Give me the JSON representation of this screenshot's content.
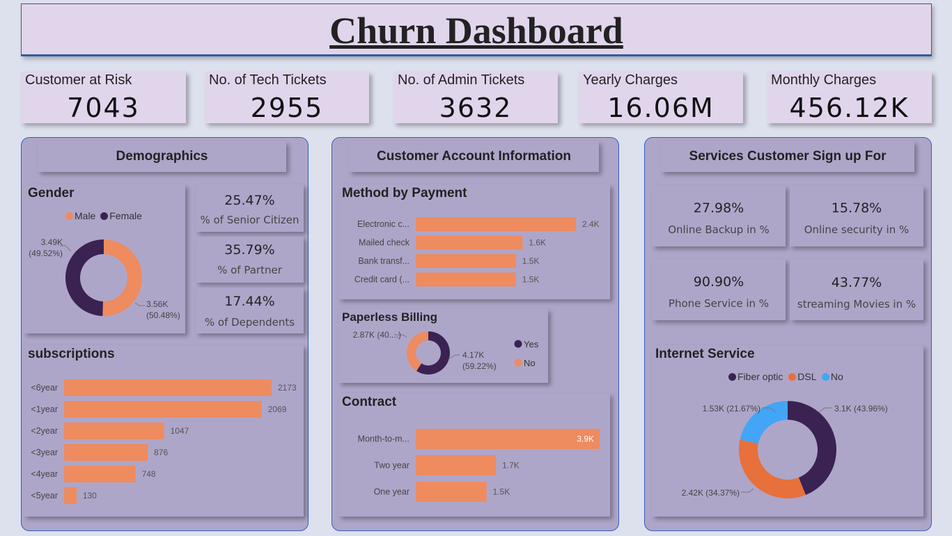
{
  "header": {
    "title": "Churn Dashboard"
  },
  "kpis": [
    {
      "label": "Customer at Risk",
      "value": "7043"
    },
    {
      "label": "No. of Tech Tickets",
      "value": "2955"
    },
    {
      "label": "No. of Admin Tickets",
      "value": "3632"
    },
    {
      "label": "Yearly Charges",
      "value": "16.06M"
    },
    {
      "label": "Monthly Charges",
      "value": "456.12K"
    }
  ],
  "demographics": {
    "heading": "Demographics",
    "stats": [
      {
        "value": "25.47%",
        "caption": "% of Senior Citizen"
      },
      {
        "value": "35.79%",
        "caption": "% of Partner"
      },
      {
        "value": "17.44%",
        "caption": "% of Dependents"
      }
    ]
  },
  "account": {
    "heading": "Customer Account Information"
  },
  "services": {
    "heading": "Services Customer Sign up For",
    "stats": [
      {
        "value": "27.98%",
        "caption": "Online Backup in %"
      },
      {
        "value": "15.78%",
        "caption": "Online security in %"
      },
      {
        "value": "90.90%",
        "caption": "Phone Service in %"
      },
      {
        "value": "43.77%",
        "caption": "streaming Movies in %"
      }
    ]
  },
  "colors": {
    "orange": "#ee8b5f",
    "purple": "#3a2253",
    "dsl": "#e8703a",
    "no_blue": "#42a5f5",
    "panel": "#aea6c9"
  },
  "chart_data": [
    {
      "id": "gender",
      "type": "pie",
      "title": "Gender",
      "categories": [
        "Male",
        "Female"
      ],
      "values": [
        3.56,
        3.49
      ],
      "unit": "K",
      "data_labels": [
        "3.56K (50.48%)",
        "3.49K (49.52%)"
      ],
      "legend": "top"
    },
    {
      "id": "subscriptions",
      "type": "bar",
      "title": "subscriptions",
      "orientation": "horizontal",
      "categories": [
        "<6year",
        "<1year",
        "<2year",
        "<3year",
        "<4year",
        "<5year"
      ],
      "values": [
        2173,
        2069,
        1047,
        876,
        748,
        130
      ],
      "data_labels": [
        "2173",
        "2069",
        "1047",
        "876",
        "748",
        "130"
      ]
    },
    {
      "id": "payment",
      "type": "bar",
      "title": "Method by Payment",
      "orientation": "horizontal",
      "categories": [
        "Electronic c...",
        "Mailed check",
        "Bank transf...",
        "Credit card (..."
      ],
      "values": [
        2.4,
        1.6,
        1.5,
        1.5
      ],
      "data_labels": [
        "2.4K",
        "1.6K",
        "1.5K",
        "1.5K"
      ]
    },
    {
      "id": "paperless",
      "type": "pie",
      "title": "Paperless Billing",
      "categories": [
        "Yes",
        "No"
      ],
      "values": [
        4.17,
        2.87
      ],
      "unit": "K",
      "data_labels": [
        "4.17K (59.22%)",
        "2.87K (40....)"
      ],
      "legend": "right"
    },
    {
      "id": "contract",
      "type": "bar",
      "title": "Contract",
      "orientation": "horizontal",
      "categories": [
        "Month-to-m...",
        "Two year",
        "One year"
      ],
      "values": [
        3.9,
        1.7,
        1.5
      ],
      "data_labels": [
        "3.9K",
        "1.7K",
        "1.5K"
      ]
    },
    {
      "id": "internet",
      "type": "pie",
      "title": "Internet Service",
      "categories": [
        "Fiber optic",
        "DSL",
        "No"
      ],
      "values": [
        3.1,
        2.42,
        1.53
      ],
      "unit": "K",
      "data_labels": [
        "3.1K (43.96%)",
        "2.42K (34.37%)",
        "1.53K (21.67%)"
      ],
      "legend": "top"
    }
  ]
}
